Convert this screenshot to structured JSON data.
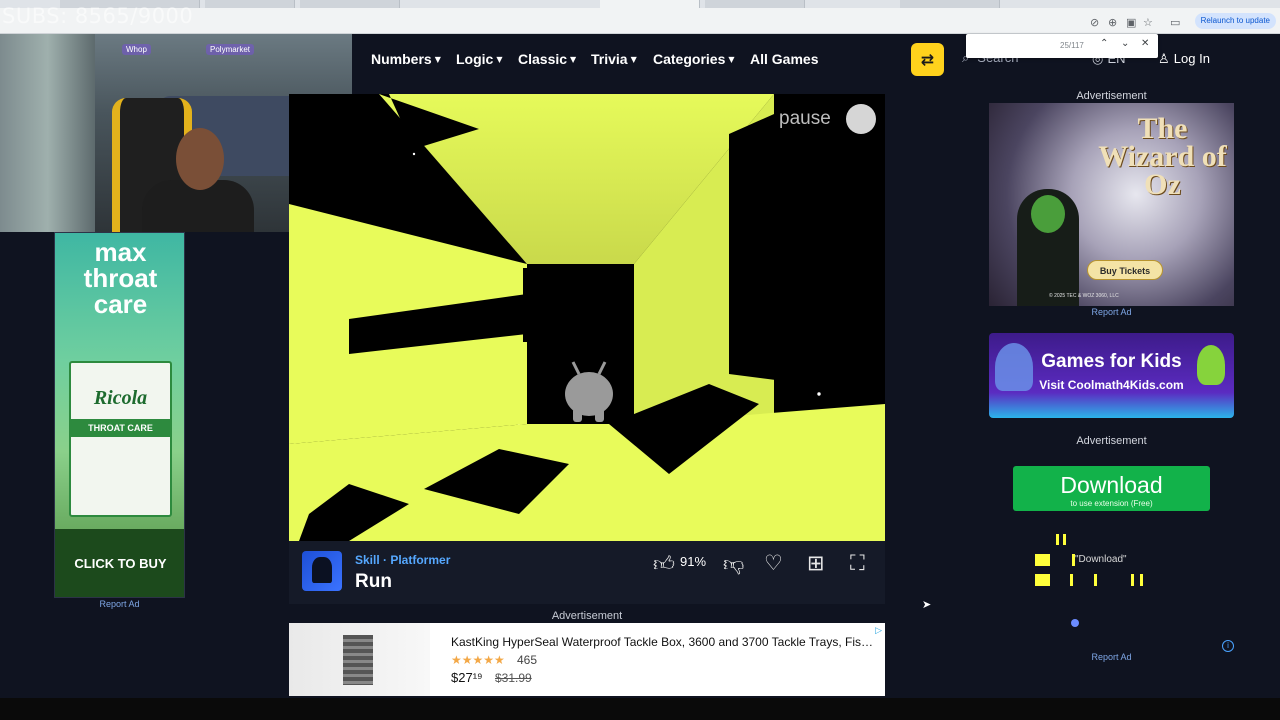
{
  "overlay": {
    "subs_counter": "SUBS: 8565/9000",
    "sponsor_1": "Whop",
    "sponsor_2": "Polymarket"
  },
  "browser": {
    "relaunch_label": "Relaunch to update",
    "find_count": "25/117"
  },
  "nav": {
    "items": [
      {
        "label": "Numbers",
        "has_menu": true
      },
      {
        "label": "Logic",
        "has_menu": true
      },
      {
        "label": "Classic",
        "has_menu": true
      },
      {
        "label": "Trivia",
        "has_menu": true
      },
      {
        "label": "Categories",
        "has_menu": true
      },
      {
        "label": "All Games",
        "has_menu": false
      }
    ],
    "search_placeholder": "Search",
    "language": "EN",
    "login": "Log In"
  },
  "left_ad": {
    "headline": "max throat care",
    "brand": "Ricola",
    "product_band": "THROAT CARE",
    "cta": "CLICK TO BUY",
    "report": "Report Ad"
  },
  "game": {
    "pause_label": "pause",
    "category_path": "Skill · Platformer",
    "title": "Run",
    "rating": "91%",
    "icons": [
      "thumbs-up",
      "thumbs-down",
      "heart",
      "add-to-playlist",
      "fullscreen"
    ]
  },
  "bottom_ad": {
    "label": "Advertisement",
    "product_title": "KastKing HyperSeal Waterproof Tackle Box, 3600 and 3700 Tackle Trays, Fishin…",
    "stars": "★★★★★",
    "review_count": "465",
    "price": "$27¹⁹",
    "old_price": "$31.99"
  },
  "right_ads": {
    "label": "Advertisement",
    "report": "Report Ad",
    "wizard": {
      "title": "The Wizard of Oz",
      "button": "Buy Tickets",
      "legal": "© 2025 TEC & WOZ 3060, LLC"
    },
    "kids": {
      "title": "Games for Kids",
      "subtitle": "Visit Coolmath4Kids.com"
    },
    "download": {
      "main": "Download",
      "sub": "to use extension (Free)",
      "note": "\"Download\""
    }
  },
  "colors": {
    "page_bg": "#0f1320",
    "accent_yellow": "#ffd21c",
    "game_yellow": "#e8fb5a",
    "download_green": "#12b24a"
  }
}
